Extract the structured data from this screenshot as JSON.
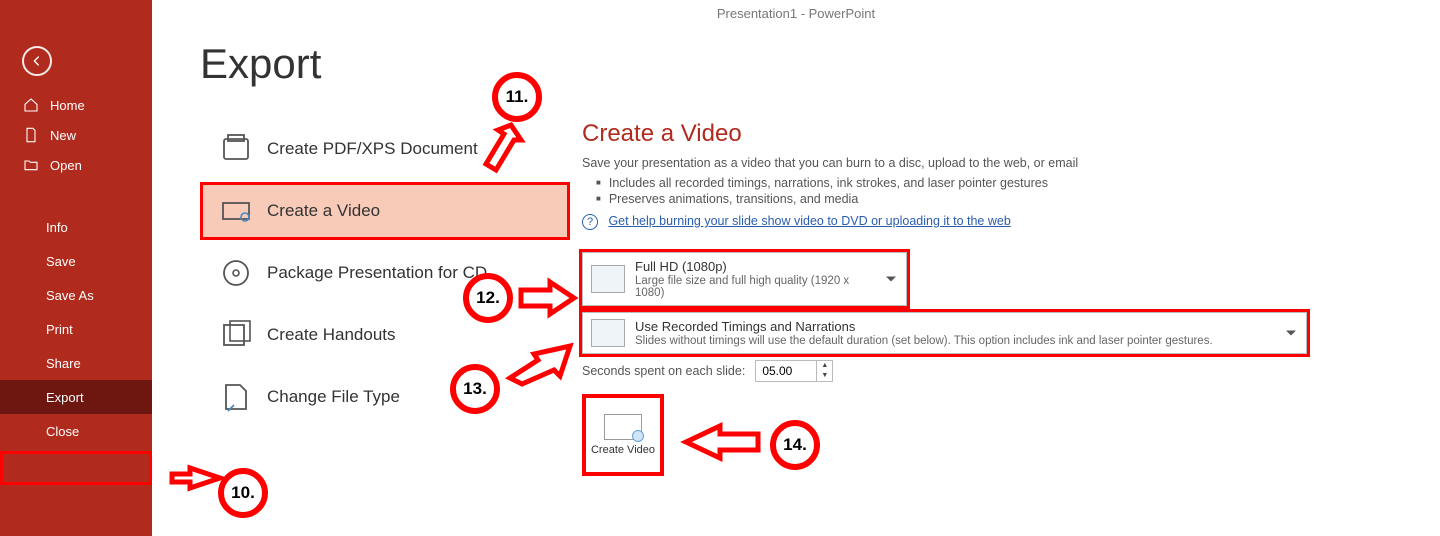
{
  "window_title": "Presentation1 - PowerPoint",
  "sidebar": {
    "back_tooltip": "Back",
    "top": [
      {
        "icon": "home",
        "label": "Home"
      },
      {
        "icon": "new",
        "label": "New"
      },
      {
        "icon": "open",
        "label": "Open"
      }
    ],
    "lower": [
      {
        "label": "Info"
      },
      {
        "label": "Save"
      },
      {
        "label": "Save As"
      },
      {
        "label": "Print"
      },
      {
        "label": "Share"
      },
      {
        "label": "Export",
        "selected": true
      },
      {
        "label": "Close"
      }
    ]
  },
  "page_title": "Export",
  "export_options": [
    {
      "icon": "pdf",
      "label": "Create PDF/XPS Document"
    },
    {
      "icon": "video",
      "label": "Create a Video",
      "selected": true
    },
    {
      "icon": "cd",
      "label": "Package Presentation for CD"
    },
    {
      "icon": "handout",
      "label": "Create Handouts"
    },
    {
      "icon": "filetype",
      "label": "Change File Type"
    }
  ],
  "detail": {
    "title": "Create a Video",
    "subtitle": "Save your presentation as a video that you can burn to a disc, upload to the web, or email",
    "bullets": [
      "Includes all recorded timings, narrations, ink strokes, and laser pointer gestures",
      "Preserves animations, transitions, and media"
    ],
    "help_link": "Get help burning your slide show video to DVD or uploading it to the web",
    "quality": {
      "title": "Full HD (1080p)",
      "sub": "Large file size and full high quality (1920 x 1080)"
    },
    "timings": {
      "title": "Use Recorded Timings and Narrations",
      "sub": "Slides without timings will use the default duration (set below). This option includes ink and laser pointer gestures."
    },
    "seconds_label": "Seconds spent on each slide:",
    "seconds_value": "05.00",
    "create_button": "Create Video"
  },
  "annotations": {
    "10": "10.",
    "11": "11.",
    "12": "12.",
    "13": "13.",
    "14": "14."
  }
}
